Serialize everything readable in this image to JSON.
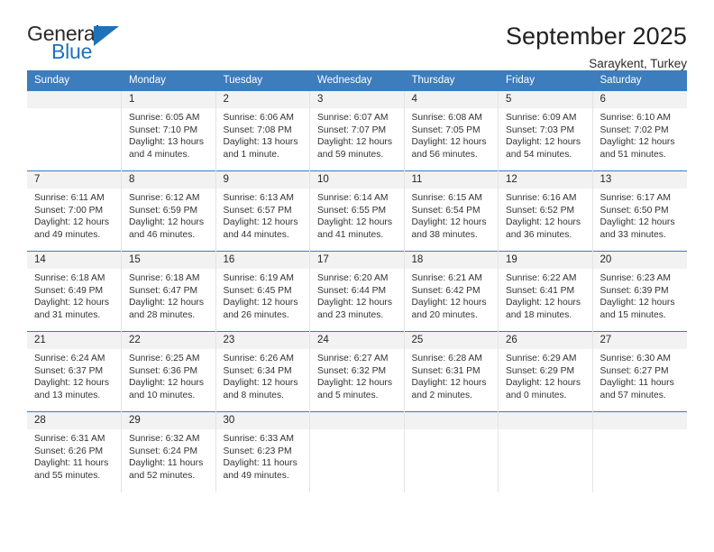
{
  "logo": {
    "line1": "General",
    "line2": "Blue",
    "accent_color": "#1c72bb"
  },
  "header": {
    "title": "September 2025",
    "subtitle": "Saraykent, Turkey"
  },
  "calendar": {
    "header_bg": "#3d7cbd",
    "daynum_bg": "#f2f2f2",
    "weekdays": [
      "Sunday",
      "Monday",
      "Tuesday",
      "Wednesday",
      "Thursday",
      "Friday",
      "Saturday"
    ],
    "weeks": [
      [
        {
          "day": "",
          "sunrise": "",
          "sunset": "",
          "daylight1": "",
          "daylight2": ""
        },
        {
          "day": "1",
          "sunrise": "Sunrise: 6:05 AM",
          "sunset": "Sunset: 7:10 PM",
          "daylight1": "Daylight: 13 hours",
          "daylight2": "and 4 minutes."
        },
        {
          "day": "2",
          "sunrise": "Sunrise: 6:06 AM",
          "sunset": "Sunset: 7:08 PM",
          "daylight1": "Daylight: 13 hours",
          "daylight2": "and 1 minute."
        },
        {
          "day": "3",
          "sunrise": "Sunrise: 6:07 AM",
          "sunset": "Sunset: 7:07 PM",
          "daylight1": "Daylight: 12 hours",
          "daylight2": "and 59 minutes."
        },
        {
          "day": "4",
          "sunrise": "Sunrise: 6:08 AM",
          "sunset": "Sunset: 7:05 PM",
          "daylight1": "Daylight: 12 hours",
          "daylight2": "and 56 minutes."
        },
        {
          "day": "5",
          "sunrise": "Sunrise: 6:09 AM",
          "sunset": "Sunset: 7:03 PM",
          "daylight1": "Daylight: 12 hours",
          "daylight2": "and 54 minutes."
        },
        {
          "day": "6",
          "sunrise": "Sunrise: 6:10 AM",
          "sunset": "Sunset: 7:02 PM",
          "daylight1": "Daylight: 12 hours",
          "daylight2": "and 51 minutes."
        }
      ],
      [
        {
          "day": "7",
          "sunrise": "Sunrise: 6:11 AM",
          "sunset": "Sunset: 7:00 PM",
          "daylight1": "Daylight: 12 hours",
          "daylight2": "and 49 minutes."
        },
        {
          "day": "8",
          "sunrise": "Sunrise: 6:12 AM",
          "sunset": "Sunset: 6:59 PM",
          "daylight1": "Daylight: 12 hours",
          "daylight2": "and 46 minutes."
        },
        {
          "day": "9",
          "sunrise": "Sunrise: 6:13 AM",
          "sunset": "Sunset: 6:57 PM",
          "daylight1": "Daylight: 12 hours",
          "daylight2": "and 44 minutes."
        },
        {
          "day": "10",
          "sunrise": "Sunrise: 6:14 AM",
          "sunset": "Sunset: 6:55 PM",
          "daylight1": "Daylight: 12 hours",
          "daylight2": "and 41 minutes."
        },
        {
          "day": "11",
          "sunrise": "Sunrise: 6:15 AM",
          "sunset": "Sunset: 6:54 PM",
          "daylight1": "Daylight: 12 hours",
          "daylight2": "and 38 minutes."
        },
        {
          "day": "12",
          "sunrise": "Sunrise: 6:16 AM",
          "sunset": "Sunset: 6:52 PM",
          "daylight1": "Daylight: 12 hours",
          "daylight2": "and 36 minutes."
        },
        {
          "day": "13",
          "sunrise": "Sunrise: 6:17 AM",
          "sunset": "Sunset: 6:50 PM",
          "daylight1": "Daylight: 12 hours",
          "daylight2": "and 33 minutes."
        }
      ],
      [
        {
          "day": "14",
          "sunrise": "Sunrise: 6:18 AM",
          "sunset": "Sunset: 6:49 PM",
          "daylight1": "Daylight: 12 hours",
          "daylight2": "and 31 minutes."
        },
        {
          "day": "15",
          "sunrise": "Sunrise: 6:18 AM",
          "sunset": "Sunset: 6:47 PM",
          "daylight1": "Daylight: 12 hours",
          "daylight2": "and 28 minutes."
        },
        {
          "day": "16",
          "sunrise": "Sunrise: 6:19 AM",
          "sunset": "Sunset: 6:45 PM",
          "daylight1": "Daylight: 12 hours",
          "daylight2": "and 26 minutes."
        },
        {
          "day": "17",
          "sunrise": "Sunrise: 6:20 AM",
          "sunset": "Sunset: 6:44 PM",
          "daylight1": "Daylight: 12 hours",
          "daylight2": "and 23 minutes."
        },
        {
          "day": "18",
          "sunrise": "Sunrise: 6:21 AM",
          "sunset": "Sunset: 6:42 PM",
          "daylight1": "Daylight: 12 hours",
          "daylight2": "and 20 minutes."
        },
        {
          "day": "19",
          "sunrise": "Sunrise: 6:22 AM",
          "sunset": "Sunset: 6:41 PM",
          "daylight1": "Daylight: 12 hours",
          "daylight2": "and 18 minutes."
        },
        {
          "day": "20",
          "sunrise": "Sunrise: 6:23 AM",
          "sunset": "Sunset: 6:39 PM",
          "daylight1": "Daylight: 12 hours",
          "daylight2": "and 15 minutes."
        }
      ],
      [
        {
          "day": "21",
          "sunrise": "Sunrise: 6:24 AM",
          "sunset": "Sunset: 6:37 PM",
          "daylight1": "Daylight: 12 hours",
          "daylight2": "and 13 minutes."
        },
        {
          "day": "22",
          "sunrise": "Sunrise: 6:25 AM",
          "sunset": "Sunset: 6:36 PM",
          "daylight1": "Daylight: 12 hours",
          "daylight2": "and 10 minutes."
        },
        {
          "day": "23",
          "sunrise": "Sunrise: 6:26 AM",
          "sunset": "Sunset: 6:34 PM",
          "daylight1": "Daylight: 12 hours",
          "daylight2": "and 8 minutes."
        },
        {
          "day": "24",
          "sunrise": "Sunrise: 6:27 AM",
          "sunset": "Sunset: 6:32 PM",
          "daylight1": "Daylight: 12 hours",
          "daylight2": "and 5 minutes."
        },
        {
          "day": "25",
          "sunrise": "Sunrise: 6:28 AM",
          "sunset": "Sunset: 6:31 PM",
          "daylight1": "Daylight: 12 hours",
          "daylight2": "and 2 minutes."
        },
        {
          "day": "26",
          "sunrise": "Sunrise: 6:29 AM",
          "sunset": "Sunset: 6:29 PM",
          "daylight1": "Daylight: 12 hours",
          "daylight2": "and 0 minutes."
        },
        {
          "day": "27",
          "sunrise": "Sunrise: 6:30 AM",
          "sunset": "Sunset: 6:27 PM",
          "daylight1": "Daylight: 11 hours",
          "daylight2": "and 57 minutes."
        }
      ],
      [
        {
          "day": "28",
          "sunrise": "Sunrise: 6:31 AM",
          "sunset": "Sunset: 6:26 PM",
          "daylight1": "Daylight: 11 hours",
          "daylight2": "and 55 minutes."
        },
        {
          "day": "29",
          "sunrise": "Sunrise: 6:32 AM",
          "sunset": "Sunset: 6:24 PM",
          "daylight1": "Daylight: 11 hours",
          "daylight2": "and 52 minutes."
        },
        {
          "day": "30",
          "sunrise": "Sunrise: 6:33 AM",
          "sunset": "Sunset: 6:23 PM",
          "daylight1": "Daylight: 11 hours",
          "daylight2": "and 49 minutes."
        },
        {
          "day": "",
          "sunrise": "",
          "sunset": "",
          "daylight1": "",
          "daylight2": ""
        },
        {
          "day": "",
          "sunrise": "",
          "sunset": "",
          "daylight1": "",
          "daylight2": ""
        },
        {
          "day": "",
          "sunrise": "",
          "sunset": "",
          "daylight1": "",
          "daylight2": ""
        },
        {
          "day": "",
          "sunrise": "",
          "sunset": "",
          "daylight1": "",
          "daylight2": ""
        }
      ]
    ]
  }
}
